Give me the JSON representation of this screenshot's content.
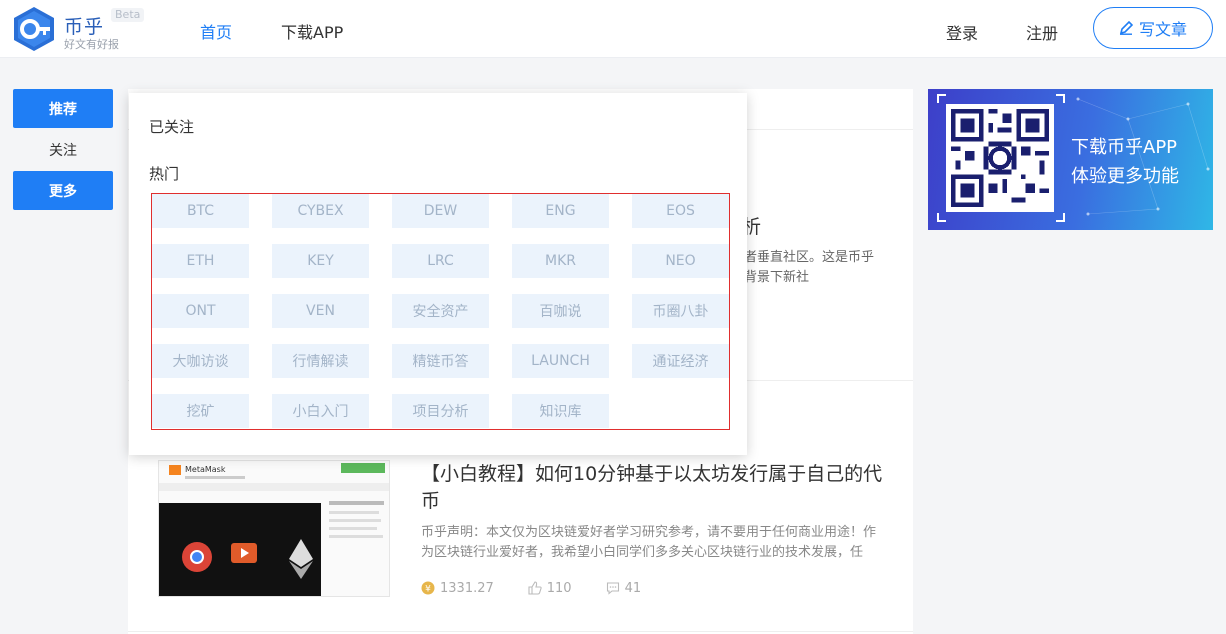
{
  "header": {
    "logo_name": "币乎",
    "logo_beta": "Beta",
    "logo_slogan": "好文有好报",
    "nav_home": "首页",
    "nav_app": "下载APP",
    "login": "登录",
    "register": "注册",
    "write_label": "写文章"
  },
  "sidebar": {
    "recommend": "推荐",
    "follow": "关注",
    "more": "更多"
  },
  "dropdown": {
    "followed_label": "已关注",
    "hot_label": "热门",
    "tags": [
      "BTC",
      "CYBEX",
      "DEW",
      "ENG",
      "EOS",
      "ETH",
      "KEY",
      "LRC",
      "MKR",
      "NEO",
      "ONT",
      "VEN",
      "安全资产",
      "百咖说",
      "币圈八卦",
      "大咖访谈",
      "行情解读",
      "精链币答",
      "LAUNCH",
      "通证经济",
      "挖矿",
      "小白入门",
      "项目分析",
      "知识库"
    ]
  },
  "article1": {
    "title_tail": "析",
    "summary": "者垂直社区。这是币乎背景下新社"
  },
  "article2": {
    "thumb_text": "MetaMask",
    "title": "【小白教程】如何10分钟基于以太坊发行属于自己的代币",
    "summary": "币乎声明：本文仅为区块链爱好者学习研究参考，请不要用于任何商业用途！作为区块链行业爱好者，我希望小白同学们多多关心区块链行业的技术发展，任",
    "reward": "1331.27",
    "likes": "110",
    "comments": "41"
  },
  "qr_banner": {
    "line1": "下载币乎APP",
    "line2": "体验更多功能"
  },
  "colors": {
    "accent": "#1f7ef5",
    "tag_bg": "#ebf3fc",
    "tag_text": "#a3b4c8",
    "frame": "#e02e2e"
  }
}
